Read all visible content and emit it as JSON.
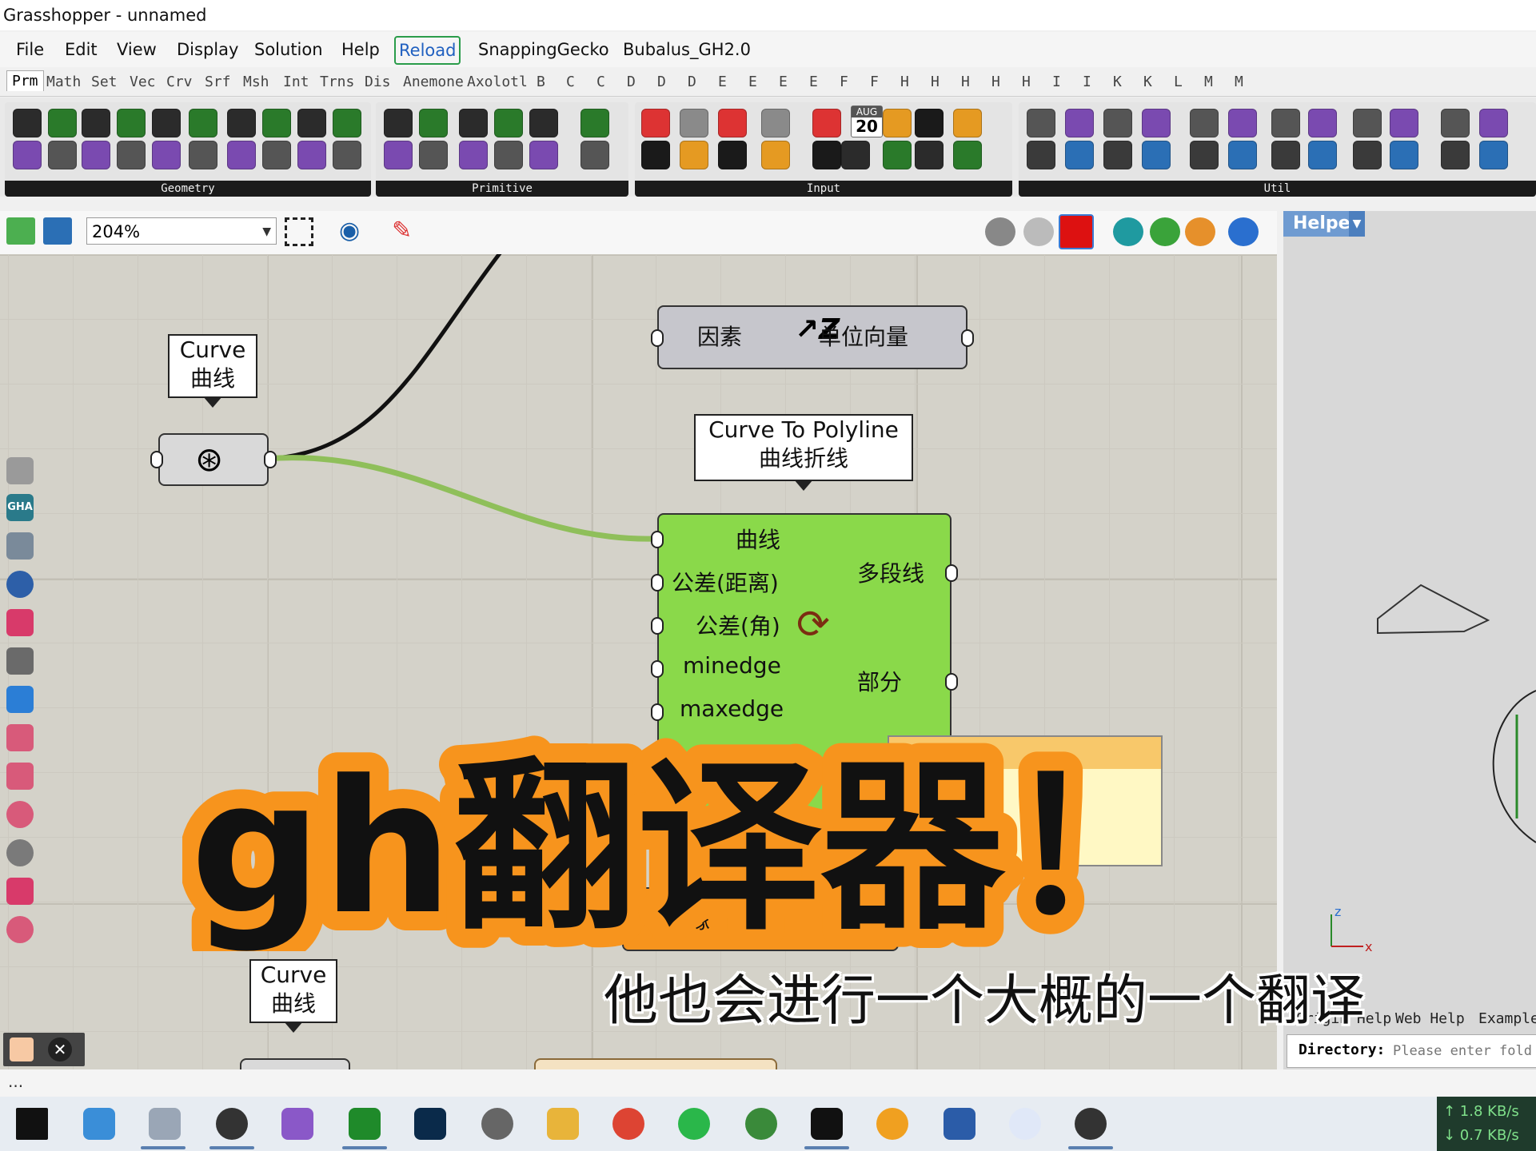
{
  "window": {
    "title": "Grasshopper - unnamed"
  },
  "menu": [
    "File",
    "Edit",
    "View",
    "Display",
    "Solution",
    "Help",
    "Reload",
    "SnappingGecko",
    "Bubalus_GH2.0"
  ],
  "tabs": [
    "Prm",
    "Math",
    "Set",
    "Vec",
    "Crv",
    "Srf",
    "Msh",
    "Int",
    "Trns",
    "Dis",
    "Anemone",
    "Axolotl",
    "B",
    "C",
    "C",
    "D",
    "D",
    "D",
    "E",
    "E",
    "E",
    "E",
    "F",
    "F",
    "H",
    "H",
    "H",
    "H",
    "H",
    "I",
    "I",
    "K",
    "K",
    "L",
    "M",
    "M"
  ],
  "ribbon_panels": [
    "Geometry",
    "Primitive",
    "Input",
    "Util"
  ],
  "input_calendar": {
    "month": "AUG",
    "day": "20"
  },
  "canvas_toolbar": {
    "zoom": "204%"
  },
  "helper_tab": "Helper",
  "canvas": {
    "vector_component": {
      "input": "因素",
      "output": "单位向量"
    },
    "curve_param_1": {
      "line1": "Curve",
      "line2": "曲线"
    },
    "polyline_tooltip": {
      "line1": "Curve To Polyline",
      "line2": "曲线折线"
    },
    "polyline_component": {
      "inputs": [
        "曲线",
        "公差(距离)",
        "公差(角)",
        "minedge",
        "maxedge"
      ],
      "outputs": [
        "多段线",
        "部分"
      ]
    },
    "curve_param_2": {
      "line1": "Curve",
      "line2": "曲线"
    },
    "orange_component": {
      "label": "缘"
    }
  },
  "rhino_panel": {
    "tabs": [
      "Origin Help",
      "Web Help",
      "Example"
    ],
    "directory_label": "Directory:",
    "directory_placeholder": "Please enter fold"
  },
  "status": "...",
  "network": {
    "up": "↑ 1.8 KB/s",
    "down": "↓ 0.7 KB/s"
  },
  "overlay": {
    "title": "gh翻译器！",
    "subtitle": "他也会进行一个大概的一个翻译"
  },
  "colors": {
    "accent_orange": "#f7941d",
    "component_green": "#8ad94a",
    "canvas": "#d4d2c9",
    "wire_green": "#8fbf5a"
  }
}
